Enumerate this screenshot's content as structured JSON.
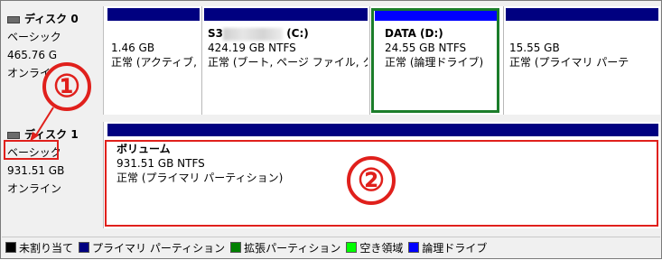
{
  "disk0": {
    "title": "ディスク 0",
    "type": "ベーシック",
    "size": "465.76 G",
    "status": "オンライ",
    "partitions": [
      {
        "name": "",
        "size": "1.46 GB",
        "status": "正常 (アクティブ,",
        "color": "#000080"
      },
      {
        "name_prefix": "S3",
        "name_suffix": "(C:)",
        "size": "424.19 GB NTFS",
        "status": "正常 (ブート, ページ ファイル, ク",
        "color": "#000080"
      },
      {
        "name": "DATA (D:)",
        "size": "24.55 GB NTFS",
        "status": "正常 (論理ドライブ)",
        "color": "#0000ff"
      },
      {
        "name": "",
        "size": "15.55 GB",
        "status": "正常 (プライマリ パーテ",
        "color": "#000080"
      }
    ]
  },
  "disk1": {
    "title": "ディスク 1",
    "type": "ベーシック",
    "size": "931.51 GB",
    "status": "オンライン",
    "partitions": [
      {
        "name": "ボリューム",
        "size": "931.51 GB NTFS",
        "status": "正常 (プライマリ パーティション)",
        "color": "#000080"
      }
    ]
  },
  "annotations": {
    "marker1": "①",
    "marker2": "②"
  },
  "legend": [
    {
      "label": "未割り当て",
      "color": "#000000"
    },
    {
      "label": "プライマリ パーティション",
      "color": "#000080"
    },
    {
      "label": "拡張パーティション",
      "color": "#008000"
    },
    {
      "label": "空き領域",
      "color": "#00ff00"
    },
    {
      "label": "論理ドライブ",
      "color": "#0000ff"
    }
  ]
}
